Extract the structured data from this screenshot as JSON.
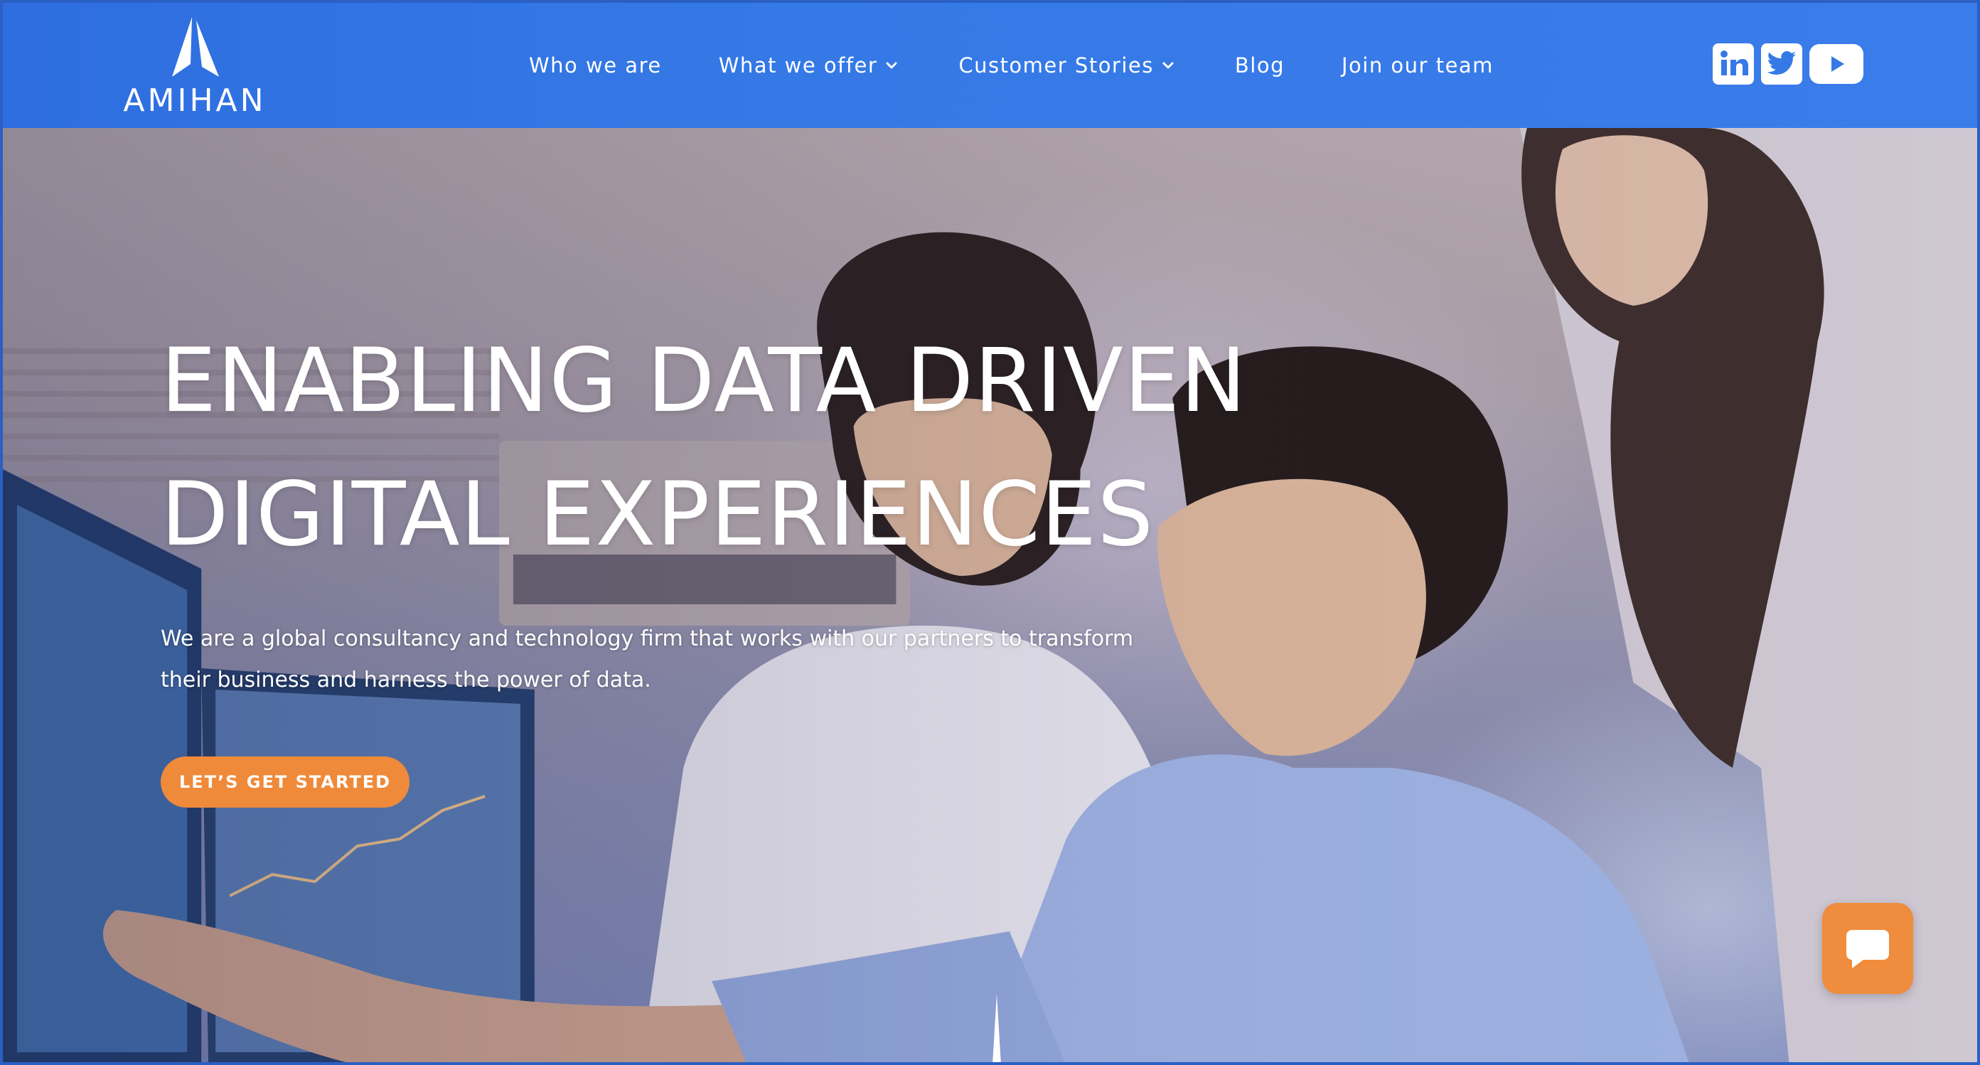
{
  "brand": {
    "name": "AMIHAN",
    "header_color": "#3579e6",
    "accent_color": "#ef8a3a"
  },
  "nav": {
    "items": [
      {
        "label": "Who we are",
        "has_dropdown": false
      },
      {
        "label": "What we offer",
        "has_dropdown": true
      },
      {
        "label": "Customer Stories",
        "has_dropdown": true
      },
      {
        "label": "Blog",
        "has_dropdown": false
      },
      {
        "label": "Join our team",
        "has_dropdown": false
      }
    ]
  },
  "social": {
    "icons": [
      "linkedin-icon",
      "twitter-icon",
      "youtube-icon"
    ]
  },
  "hero": {
    "title_line1": "ENABLING DATA DRIVEN",
    "title_line2": "DIGITAL EXPERIENCES",
    "subtitle": "We are a global consultancy and technology firm that works with our partners to transform their business and harness the power of data.",
    "cta_label": "LET’S GET STARTED"
  },
  "chat": {
    "icon": "chat-bubble-icon"
  }
}
